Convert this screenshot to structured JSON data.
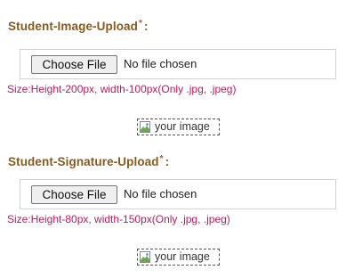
{
  "image_upload": {
    "label": "Student-Image-Upload",
    "required_mark": "*",
    "colon": ":",
    "button_label": "Choose File",
    "status": "No file chosen",
    "size_hint": "Size:Height-200px, width-100px(Only .jpg, .jpeg)",
    "preview_alt": "your image"
  },
  "signature_upload": {
    "label": "Student-Signature-Upload",
    "required_mark": "*",
    "colon": ":",
    "button_label": "Choose File",
    "status": "No file chosen",
    "size_hint": "Size:Height-80px, width-150px(Only .jpg, .jpeg)",
    "preview_alt": "your image"
  },
  "colors": {
    "label": "#8a5a1b",
    "required": "#e53935",
    "hint": "#c2185b"
  },
  "icons": {
    "preview_placeholder": "broken-image-icon"
  }
}
